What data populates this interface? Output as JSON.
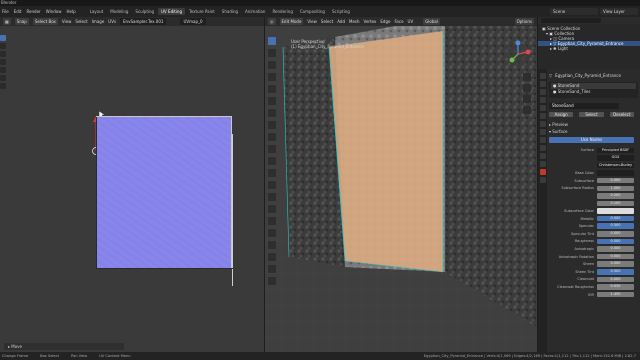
{
  "app": {
    "title": "Blender"
  },
  "topbar": {
    "menus": [
      "File",
      "Edit",
      "Render",
      "Window",
      "Help"
    ],
    "workspaces": [
      "Layout",
      "Modeling",
      "Sculpting",
      "UV Editing",
      "Texture Paint",
      "Shading",
      "Animation",
      "Rendering",
      "Compositing",
      "Scripting"
    ],
    "active_workspace": "UV Editing",
    "scene": "Scene",
    "view_layer": "View Layer"
  },
  "uv_editor": {
    "header": {
      "mode_icon": "uv-editor-icon",
      "sync_label": "Snap",
      "select_mode": "Select Box",
      "view_label": "View",
      "select_label": "Select",
      "image_label": "Image",
      "uvs_label": "UVs",
      "image_name": "EnvSampler.Tex.001",
      "uvmap": "UVmap_0"
    },
    "operator_panel": "Move"
  },
  "viewport": {
    "header": {
      "mode": "Edit Mode",
      "view": "View",
      "select": "Select",
      "add": "Add",
      "mesh": "Mesh",
      "vertex": "Vertex",
      "edge": "Edge",
      "face": "Face",
      "uv": "UV",
      "transform": "Global",
      "options": "Options"
    },
    "overlay_title": "User Perspective",
    "overlay_object": "(1) Egyptian_City_Pyramid_Entrance"
  },
  "outliner": {
    "items": [
      {
        "label": "Scene Collection",
        "selected": false,
        "indent": 0
      },
      {
        "label": "Collection",
        "selected": false,
        "indent": 1
      },
      {
        "label": "Camera",
        "selected": false,
        "indent": 2
      },
      {
        "label": "Egyptian_City_Pyramid_Entrance",
        "selected": true,
        "indent": 2
      },
      {
        "label": "Light",
        "selected": false,
        "indent": 2
      }
    ]
  },
  "properties": {
    "object_name": "Egyptian_City_Pyramid_Entrance",
    "material_slots": [
      "StoneSand",
      "StoneSand_Tiles"
    ],
    "material_name": "StoneSand",
    "actions": [
      "Assign",
      "Select",
      "Deselect"
    ],
    "sections": [
      "Preview",
      "Surface"
    ],
    "use_nodes": "Use Nodes",
    "surface_shader": "Principled BSDF",
    "distribution": "GGX",
    "subsurface_method": "Christensen-Burley",
    "rows": [
      {
        "label": "Base Color",
        "value": "",
        "style": "dark"
      },
      {
        "label": "Subsurface",
        "value": "0.000",
        "style": "grey"
      },
      {
        "label": "Subsurface Radius",
        "value": "1.000",
        "style": "grey"
      },
      {
        "label": "",
        "value": "0.200",
        "style": "grey"
      },
      {
        "label": "",
        "value": "0.100",
        "style": "grey"
      },
      {
        "label": "Subsurface Color",
        "value": "",
        "style": "white"
      },
      {
        "label": "Metallic",
        "value": "0.000",
        "style": "blue"
      },
      {
        "label": "Specular",
        "value": "0.500",
        "style": "blue"
      },
      {
        "label": "Specular Tint",
        "value": "0.000",
        "style": "grey"
      },
      {
        "label": "Roughness",
        "value": "0.500",
        "style": "blue"
      },
      {
        "label": "Anisotropic",
        "value": "0.000",
        "style": "grey"
      },
      {
        "label": "Anisotropic Rotation",
        "value": "0.000",
        "style": "grey"
      },
      {
        "label": "Sheen",
        "value": "0.000",
        "style": "grey"
      },
      {
        "label": "Sheen Tint",
        "value": "0.500",
        "style": "blue"
      },
      {
        "label": "Clearcoat",
        "value": "0.000",
        "style": "grey"
      },
      {
        "label": "Clearcoat Roughness",
        "value": "0.030",
        "style": "grey"
      },
      {
        "label": "IOR",
        "value": "1.450",
        "style": "grey"
      }
    ]
  },
  "statusbar": {
    "left_1": "Change Frame",
    "left_2": "Box Select",
    "left_3": "Pan View",
    "left_4": "UV Context Menu",
    "stats": "Egyptian_City_Pyramid_Entrance | Verts:4/1,069 | Edges:4/2,169 | Faces:1/1,112 | Tris:1,112 | Mem:152.6 MiB | 2.82.7"
  },
  "colors": {
    "accent": "#4772b3",
    "uv_texture": "#8288ec",
    "wall_highlight": "#d9aa80",
    "edge_teal": "#2ec6c6"
  }
}
